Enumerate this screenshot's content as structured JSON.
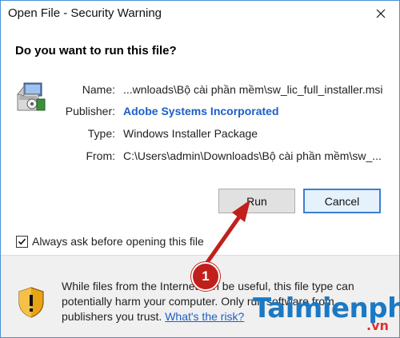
{
  "window": {
    "title": "Open File - Security Warning",
    "close_glyph": "✕"
  },
  "dialog": {
    "question": "Do you want to run this file?",
    "icon": "installer-package-icon",
    "fields": {
      "name_label": "Name:",
      "name_value": "...wnloads\\Bộ cài phần mềm\\sw_lic_full_installer.msi",
      "publisher_label": "Publisher:",
      "publisher_value": "Adobe Systems Incorporated",
      "type_label": "Type:",
      "type_value": "Windows Installer Package",
      "from_label": "From:",
      "from_value": "C:\\Users\\admin\\Downloads\\Bộ cài phần mềm\\sw_..."
    },
    "buttons": {
      "run_label": "Run",
      "cancel_label": "Cancel"
    },
    "checkbox": {
      "label": "Always ask before opening this file",
      "checked": true
    }
  },
  "warning": {
    "icon": "security-shield-icon",
    "line1": "While files from the Internet can be useful, this file type can",
    "line2": "potentially harm your computer. Only run software from",
    "line3": "publishers you trust.",
    "link": "What's the risk?"
  },
  "annotation": {
    "step_number": "1",
    "color": "#c0201c"
  },
  "watermark": {
    "brand": "Taimienphi",
    "suffix": ".vn"
  },
  "colors": {
    "link": "#1a5fc7",
    "default_button_border": "#3c7fd6",
    "bottom_panel": "#f0f0f0"
  }
}
